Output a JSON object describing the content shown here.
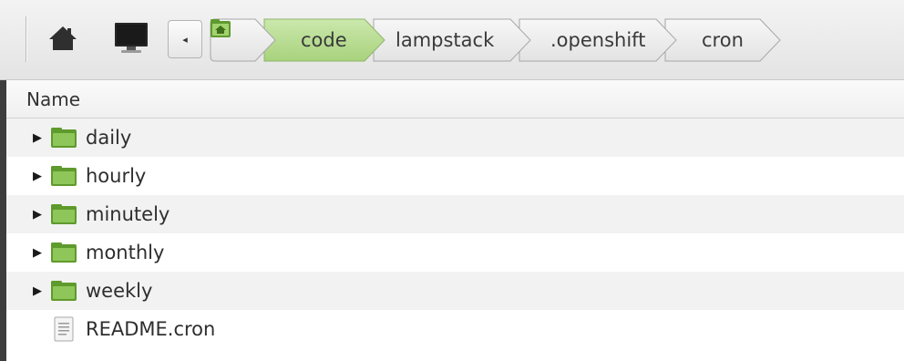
{
  "toolbar": {
    "home_icon": "home-icon",
    "computer_icon": "computer-icon",
    "back_icon": "chevron-left-icon",
    "back_glyph": "◂"
  },
  "breadcrumb": {
    "root_icon": "home-folder-icon",
    "items": [
      {
        "label": "code",
        "active": true
      },
      {
        "label": "lampstack",
        "active": false
      },
      {
        "label": ".openshift",
        "active": false
      },
      {
        "label": "cron",
        "active": false
      }
    ]
  },
  "list": {
    "column_header": "Name",
    "rows": [
      {
        "name": "daily",
        "type": "folder",
        "icon": "folder-icon",
        "expander": "▶"
      },
      {
        "name": "hourly",
        "type": "folder",
        "icon": "folder-icon",
        "expander": "▶"
      },
      {
        "name": "minutely",
        "type": "folder",
        "icon": "folder-icon",
        "expander": "▶"
      },
      {
        "name": "monthly",
        "type": "folder",
        "icon": "folder-icon",
        "expander": "▶"
      },
      {
        "name": "weekly",
        "type": "folder",
        "icon": "folder-icon",
        "expander": "▶"
      },
      {
        "name": "README.cron",
        "type": "file",
        "icon": "text-file-icon",
        "expander": ""
      }
    ]
  },
  "colors": {
    "active_crumb": "#b4d98f",
    "folder_green": "#6aa536",
    "folder_light": "#9dcd6a"
  }
}
